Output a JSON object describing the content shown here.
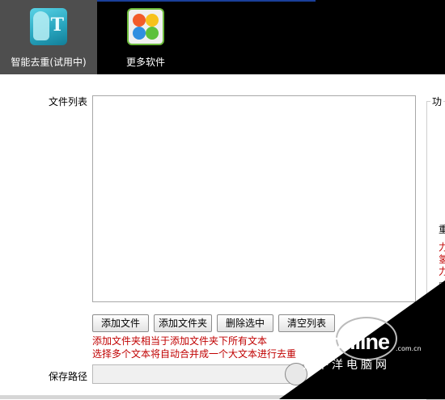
{
  "toolbar": {
    "items": [
      {
        "label": "智能去重(试用中)",
        "icon": "dedup-t-icon",
        "active": true
      },
      {
        "label": "更多软件",
        "icon": "more-software-icon",
        "active": false
      }
    ]
  },
  "main": {
    "file_list_label": "文件列表",
    "function_group_label": "功",
    "side_label": "重",
    "side_red_lines": [
      "力",
      "氢",
      "力"
    ],
    "buttons": [
      "添加文件",
      "添加文件夹",
      "删除选中",
      "清空列表"
    ],
    "notes": [
      "添加文件夹相当于添加文件夹下所有文本",
      "选择多个文本将自动合并成一个大文本进行去重"
    ],
    "save_path_label": "保存路径",
    "save_path_value": ""
  },
  "watermark": {
    "brand": "PConline",
    "domain": ".com.cn",
    "subtitle": "太平洋电脑网"
  },
  "colors": {
    "toolbar_bg": "#000000",
    "active_tool_bg": "#4e4e4e",
    "note_red": "#c00000"
  }
}
